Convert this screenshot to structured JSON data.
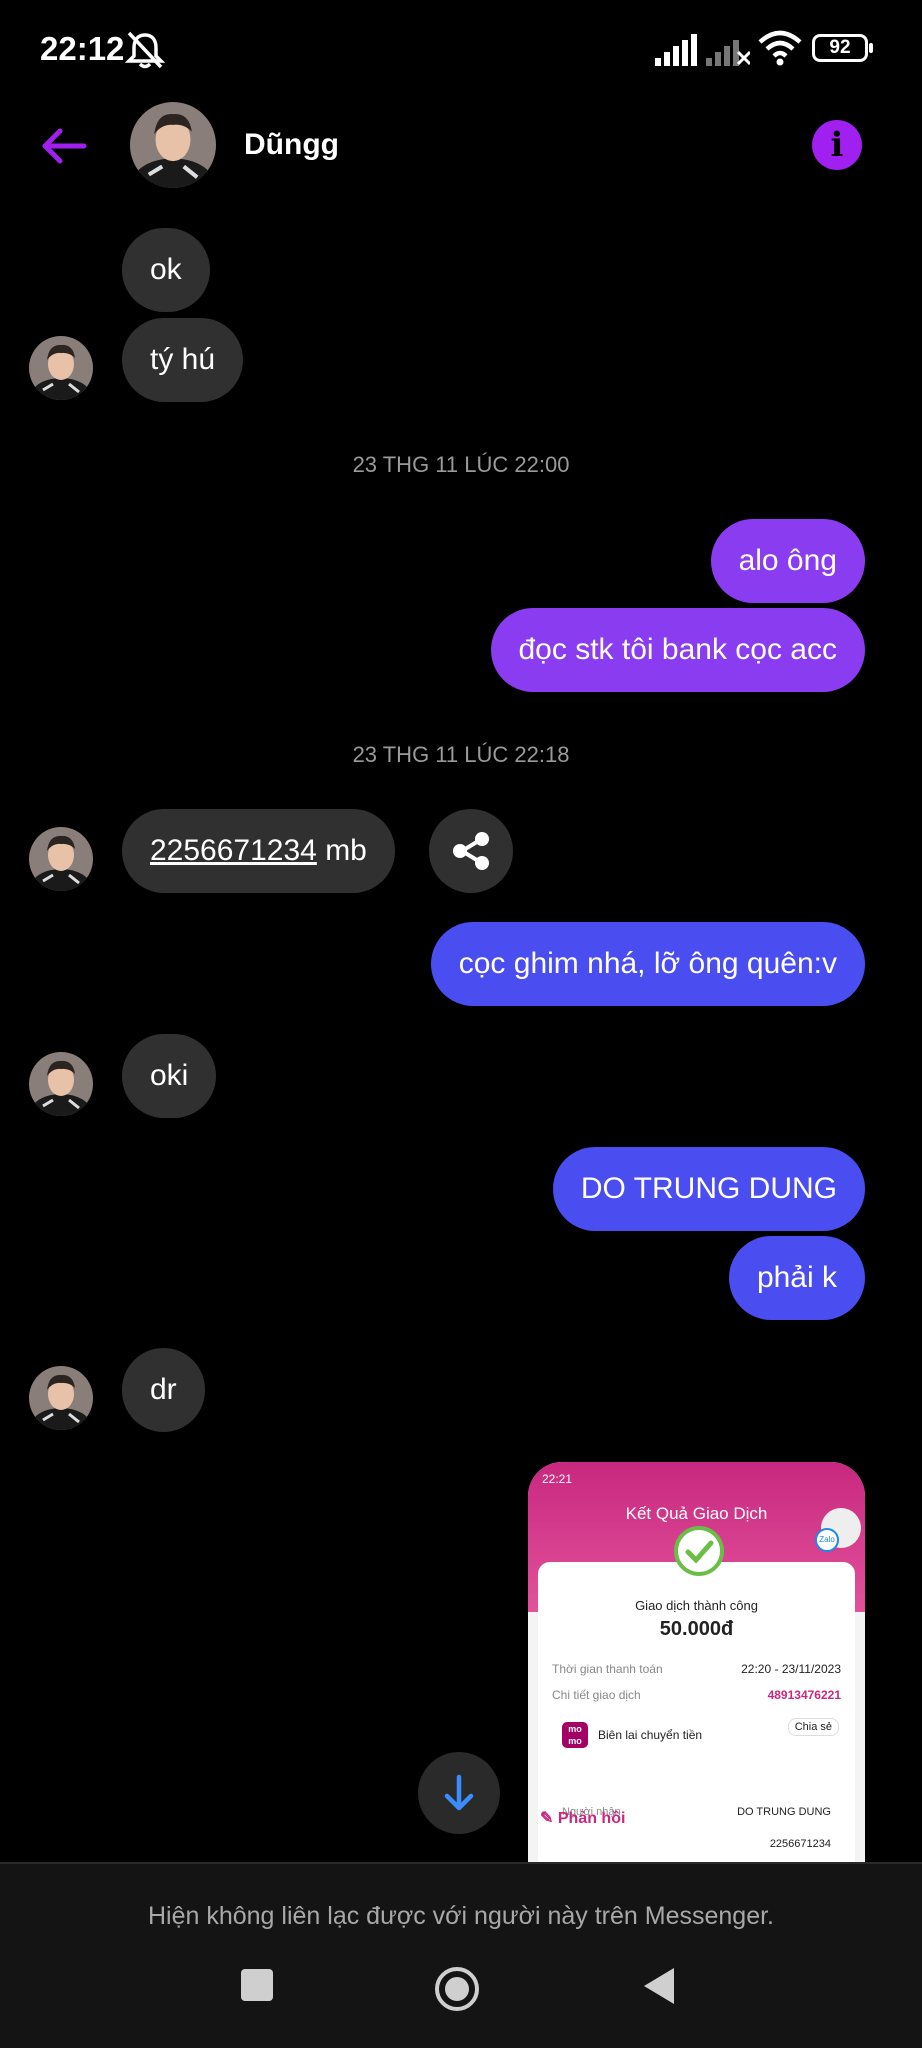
{
  "status_bar": {
    "time": "22:12",
    "battery": "92"
  },
  "header": {
    "contact_name": "Dũngg",
    "back_icon": "back-arrow-icon",
    "info_icon": "info-icon"
  },
  "accent": {
    "purple": "#8a3cf0",
    "blue": "#4a4df0",
    "info": "#a020f0"
  },
  "messages": [
    {
      "side": "in",
      "text": "ok"
    },
    {
      "side": "in",
      "text": "tý hú"
    },
    {
      "type": "timestamp",
      "text": "23 THG 11 LÚC 22:00"
    },
    {
      "side": "out",
      "text": "alo ông"
    },
    {
      "side": "out",
      "text": "đọc stk tôi bank cọc acc"
    },
    {
      "type": "timestamp",
      "text": "23 THG 11 LÚC 22:18"
    },
    {
      "side": "in",
      "link": "2256671234",
      "text": " mb"
    },
    {
      "side": "out",
      "text": "cọc ghim nhá, lỡ ông quên:v"
    },
    {
      "side": "in",
      "text": "oki"
    },
    {
      "side": "out",
      "text": "DO TRUNG DUNG"
    },
    {
      "side": "out",
      "text": "phải k"
    },
    {
      "side": "in",
      "text": "dr"
    }
  ],
  "image_message": {
    "status_time": "22:21",
    "title": "Kết Quả Giao Dịch",
    "badge": "Zalo",
    "success": "Giao dịch thành công",
    "amount": "50.000đ",
    "time_label": "Thời gian thanh toán",
    "time_value": "22:20 - 23/11/2023",
    "detail_label": "Chi tiết giao dịch",
    "detail_value": "48913476221",
    "receipt_label": "Biên lai chuyển tiền",
    "share_label": "Chia sẻ",
    "momo_logo": "mo mo",
    "recipient_label": "Người nhận",
    "recipient_value": "DO TRUNG DUNG",
    "account_value": "2256671234"
  },
  "reply_label": "Phản hồi",
  "footer_notice": "Hiện không liên lạc được với người này trên Messenger."
}
